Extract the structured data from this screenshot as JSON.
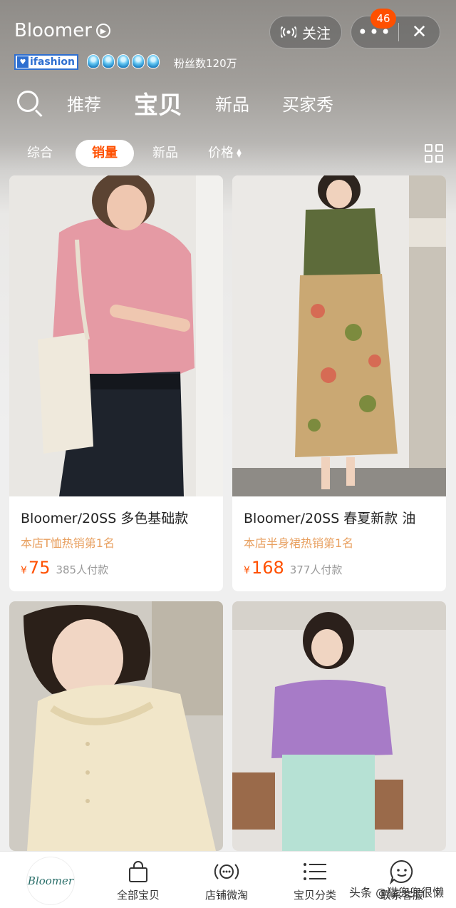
{
  "header": {
    "shop_name": "Bloomer",
    "ifashion_label": "ifashion",
    "fans_label": "粉丝数120万",
    "follow_label": "关注",
    "more_label": "•••",
    "notification_count": "46",
    "close_label": "✕"
  },
  "tabs": [
    {
      "label": "推荐",
      "active": false
    },
    {
      "label": "宝贝",
      "active": true
    },
    {
      "label": "新品",
      "active": false
    },
    {
      "label": "买家秀",
      "active": false
    }
  ],
  "sorts": [
    {
      "label": "综合",
      "active": false
    },
    {
      "label": "销量",
      "active": true
    },
    {
      "label": "新品",
      "active": false
    },
    {
      "label": "价格",
      "active": false
    }
  ],
  "products": [
    {
      "title": "Bloomer/20SS 多色基础款",
      "tag": "本店T恤热销第1名",
      "currency": "¥",
      "price": "75",
      "sold": "385人付款"
    },
    {
      "title": "Bloomer/20SS 春夏新款 油",
      "tag": "本店半身裙热销第1名",
      "currency": "¥",
      "price": "168",
      "sold": "377人付款"
    },
    {
      "title": "",
      "tag": "",
      "currency": "",
      "price": "",
      "sold": ""
    },
    {
      "title": "",
      "tag": "",
      "currency": "",
      "price": "",
      "sold": ""
    }
  ],
  "bottom_nav": {
    "logo_text": "Bloomer",
    "items": [
      {
        "label": "全部宝贝",
        "icon": "shopping-bag-icon"
      },
      {
        "label": "店铺微淘",
        "icon": "broadcast-icon"
      },
      {
        "label": "宝贝分类",
        "icon": "list-icon"
      },
      {
        "label": "联系客服",
        "icon": "chat-face-icon"
      }
    ]
  },
  "watermark": "头条 @猫兜兜很懒",
  "colors": {
    "accent": "#ff5000",
    "tag": "#e8a060"
  }
}
